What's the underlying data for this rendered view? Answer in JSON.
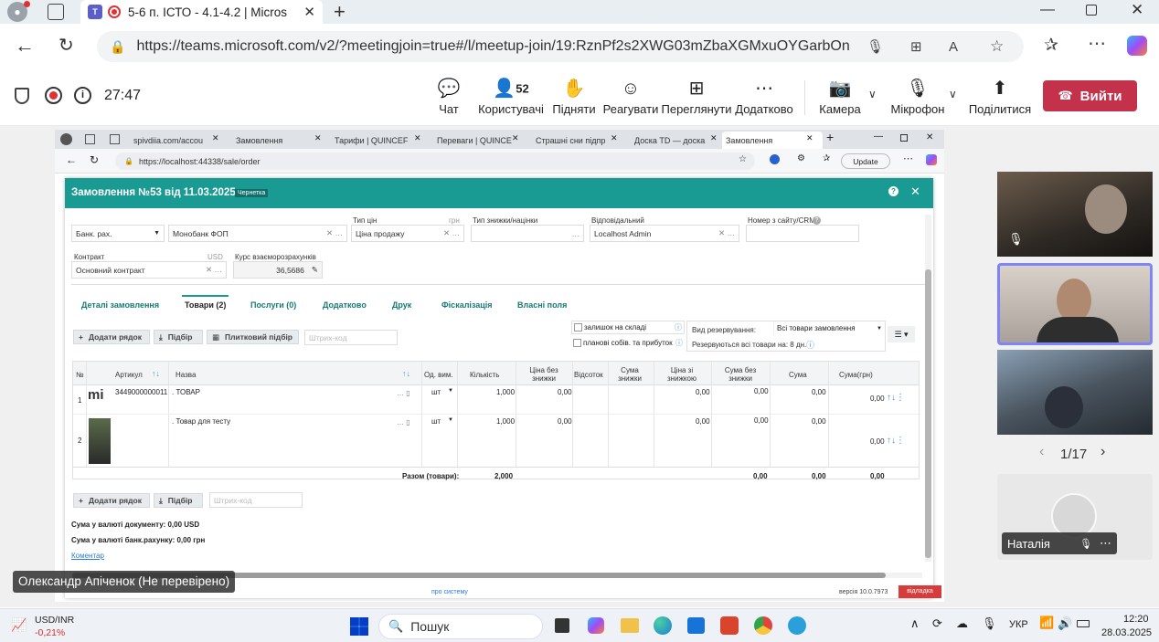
{
  "browser": {
    "tab_title": "5-6 п. ІСТО - 4.1-4.2 | Micros",
    "url": "https://teams.microsoft.com/v2/?meetingjoin=true#/l/meetup-join/19:RznPf2s2XWG03mZbaXGMxuOYGarbOn8..."
  },
  "teams": {
    "timer": "27:47",
    "chat": "Чат",
    "people": "Користувачі",
    "people_count": "52",
    "raise": "Підняти",
    "react": "Реагувати",
    "view": "Переглянути",
    "more": "Додатково",
    "camera": "Камера",
    "mic": "Мікрофон",
    "share": "Поділитися",
    "leave": "Вийти"
  },
  "inner_browser": {
    "tabs": [
      "spivdiia.com/accou",
      "Замовлення",
      "Тарифи | QUINCEF",
      "Переваги | QUINCE",
      "Страшні сни підпр",
      "Доска TD — доска",
      "Замовлення"
    ],
    "url": "https://localhost:44338/sale/order",
    "update": "Update"
  },
  "order": {
    "title": "Замовлення №53 від 11.03.2025",
    "badge": "Чернетка",
    "bank_label": "Банк. рах.",
    "bank_value": "Монобанк ФОП",
    "price_type_label": "Тип цін",
    "price_currency": "грн",
    "price_type_value": "Ціна продажу",
    "discount_label": "Тип знижки/націнки",
    "responsible_label": "Відповідальний",
    "responsible_value": "Localhost Admin",
    "crm_label": "Номер з сайту/CRM",
    "contract_label": "Контракт",
    "contract_currency": "USD",
    "contract_value": "Основний контракт",
    "rate_label": "Курс взаєморозрахунків",
    "rate_value": "36,5686",
    "tabs": [
      "Деталі замовлення",
      "Товари (2)",
      "Послуги (0)",
      "Додатково",
      "Друк",
      "Фіскалізація",
      "Власні поля"
    ],
    "add_row": "Додати рядок",
    "pick": "Підбір",
    "tile_pick": "Плитковий підбір",
    "barcode_placeholder": "Штрих-код",
    "stock_check": "залишок на складі",
    "cost_check": "планові собів. та прибуток",
    "reserve_label": "Вид резервування:",
    "reserve_value": "Всі товари замовлення",
    "reserve_days": "Резервуються всі товари на: 8 дн.",
    "columns": [
      "№",
      "Артикул",
      "Назва",
      "Од. вим.",
      "Кількість",
      "Ціна без знижки",
      "Відсоток",
      "Сума знижки",
      "Ціна зі знижкою",
      "Сума без знижки",
      "Сума",
      "Сума(грн)"
    ],
    "rows": [
      {
        "n": "1",
        "sku": "3449000000011",
        "name": ". ТОВАР",
        "unit": "шт",
        "qty": "1,000",
        "price": "0,00",
        "pct": "",
        "disc": "",
        "pdisc": "0,00",
        "sumnd": "0,00",
        "sum": "0,00",
        "sumuah": "0,00",
        "thumb": "mi"
      },
      {
        "n": "2",
        "sku": "",
        "name": ". Товар для тесту",
        "unit": "шт",
        "qty": "1,000",
        "price": "0,00",
        "pct": "",
        "disc": "",
        "pdisc": "0,00",
        "sumnd": "0,00",
        "sum": "0,00",
        "sumuah": "0,00",
        "thumb": ""
      }
    ],
    "total_label": "Разом (товари):",
    "total_qty": "2,000",
    "total_sumnd": "0,00",
    "total_sum": "0,00",
    "total_uah": "0,00",
    "sum_doc": "Сума у валюті документу: 0,00 USD",
    "sum_bank": "Сума у валюті банк.рахунку: 0,00 грн",
    "comment": "Коментар",
    "about": "про систему",
    "version": "версія 10.0.7973",
    "debug": "відладка"
  },
  "presenter": "Олександр Апіченок (Не перевірено)",
  "participants": {
    "page": "1/17",
    "self_name": "Наталія"
  },
  "taskbar": {
    "ticker": "USD/INR",
    "change": "-0,21%",
    "search": "Пошук",
    "lang": "УКР",
    "time": "12:20",
    "date": "28.03.2025"
  }
}
